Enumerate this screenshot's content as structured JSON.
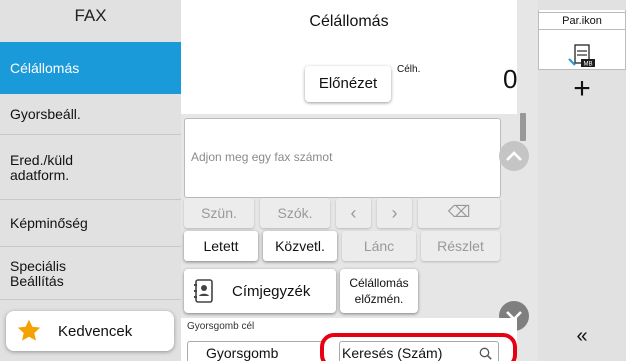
{
  "sidebar": {
    "title": "FAX",
    "items": [
      {
        "label": "Célállomás",
        "active": true
      },
      {
        "label": "Gyorsbeáll.",
        "active": false
      },
      {
        "label": "Ered./küld",
        "label2": "adatform.",
        "active": false
      },
      {
        "label": "Képminőség",
        "active": false
      },
      {
        "label": "Speciális",
        "label2": "Beállítás",
        "active": false
      }
    ],
    "favorites_label": "Kedvencek"
  },
  "main": {
    "title": "Célállomás",
    "preview_label": "Előnézet",
    "dest_count_label": "Célh.",
    "dest_count": "0",
    "fax_input_placeholder": "Adjon meg egy fax számot",
    "keys_row1": [
      "Szün.",
      "Szók.",
      "‹",
      "›",
      "⌫"
    ],
    "keys_row2": [
      "Letett",
      "Közvetl.",
      "Lánc",
      "Részlet"
    ],
    "address_book_label": "Címjegyzék",
    "dest_history_line1": "Célállomás",
    "dest_history_line2": "előzmén.",
    "quick_label": "Gyorsgomb cél",
    "quick_button": "Gyorsgomb",
    "search_button": "Keresés (Szám)"
  },
  "right_panel": {
    "tab_label": "Par.ikon",
    "plus_symbol": "+",
    "collapse_symbol": "«"
  },
  "colors": {
    "accent": "#1a9ad8",
    "highlight_ring": "#e60012",
    "star": "#f5a100"
  }
}
